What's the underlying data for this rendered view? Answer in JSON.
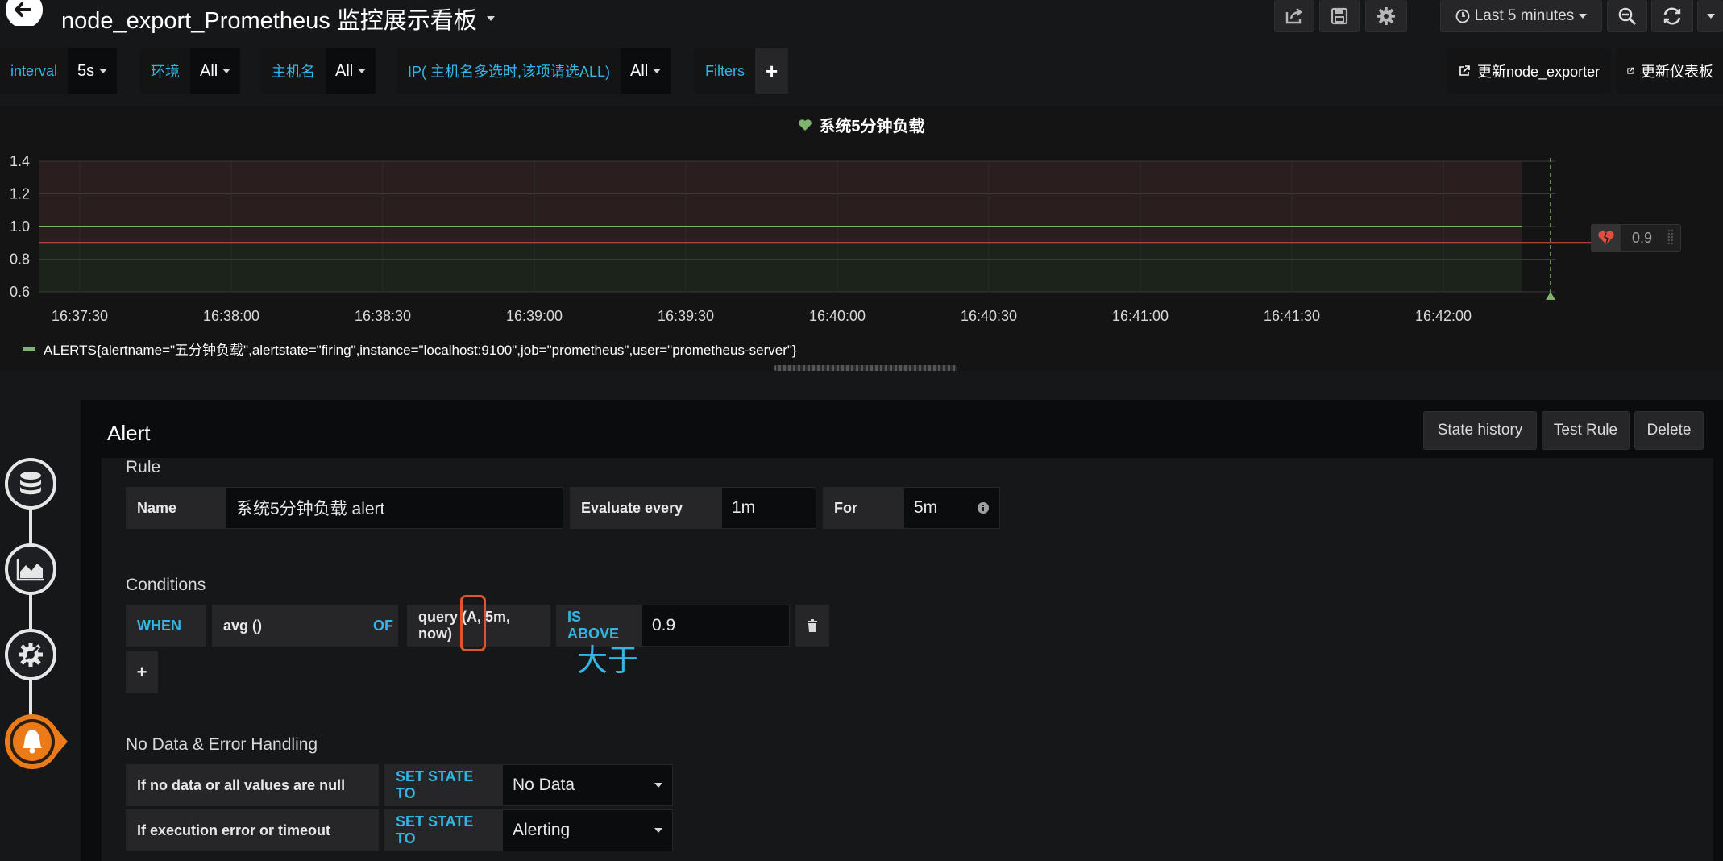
{
  "header": {
    "title": "node_export_Prometheus 监控展示看板",
    "time_range": "Last 5 minutes"
  },
  "variables": [
    {
      "label": "interval",
      "value": "5s"
    },
    {
      "label": "环境",
      "value": "All"
    },
    {
      "label": "主机名",
      "value": "All"
    },
    {
      "label": "IP( 主机名多选时,该项请选ALL)",
      "value": "All"
    },
    {
      "label": "Filters",
      "value": "+"
    }
  ],
  "links": {
    "update_exporter": "更新node_exporter",
    "update_dashboard": "更新仪表板"
  },
  "panel": {
    "title": "系统5分钟负载",
    "threshold_value": "0.9",
    "legend": "ALERTS{alertname=\"五分钟负载\",alertstate=\"firing\",instance=\"localhost:9100\",job=\"prometheus\",user=\"prometheus-server\"}"
  },
  "chart_data": {
    "type": "line",
    "x": [
      "16:37:30",
      "16:38:00",
      "16:38:30",
      "16:39:00",
      "16:39:30",
      "16:40:00",
      "16:40:30",
      "16:41:00",
      "16:41:30",
      "16:42:00"
    ],
    "y_ticks": [
      "1.4",
      "1.2",
      "1.0",
      "0.8",
      "0.6"
    ],
    "ylim": [
      0.6,
      1.4
    ],
    "series": [
      {
        "name": "ALERTS{alertname=\"五分钟负载\",alertstate=\"firing\",instance=\"localhost:9100\",job=\"prometheus\",user=\"prometheus-server\"}",
        "values": [
          1,
          1,
          1,
          1,
          1,
          1,
          1,
          1,
          1,
          1
        ],
        "color": "#7eb26d"
      }
    ],
    "threshold": 0.9,
    "threshold_color": "#e24d42",
    "grid": true
  },
  "alert": {
    "title": "Alert",
    "buttons": {
      "state_history": "State history",
      "test_rule": "Test Rule",
      "delete": "Delete"
    },
    "rule": {
      "section": "Rule",
      "name_label": "Name",
      "name_value": "系统5分钟负载 alert",
      "eval_label": "Evaluate every",
      "eval_value": "1m",
      "for_label": "For",
      "for_value": "5m"
    },
    "conditions": {
      "section": "Conditions",
      "when": "WHEN",
      "reducer": "avg ()",
      "of": "OF",
      "query": "query (A, 5m, now)",
      "evaluator": "IS ABOVE",
      "threshold": "0.9",
      "add": "+",
      "annotation": "大于"
    },
    "nodata": {
      "section": "No Data & Error Handling",
      "row1_label": "If no data or all values are null",
      "row1_set": "SET STATE TO",
      "row1_value": "No Data",
      "row2_label": "If execution error or timeout",
      "row2_set": "SET STATE TO",
      "row2_value": "Alerting"
    }
  },
  "colors": {
    "accent": "#33b5e5",
    "ok": "#7eb26d",
    "alert": "#e24d42",
    "highlight": "#e0552a",
    "bell": "#eb7b18"
  }
}
